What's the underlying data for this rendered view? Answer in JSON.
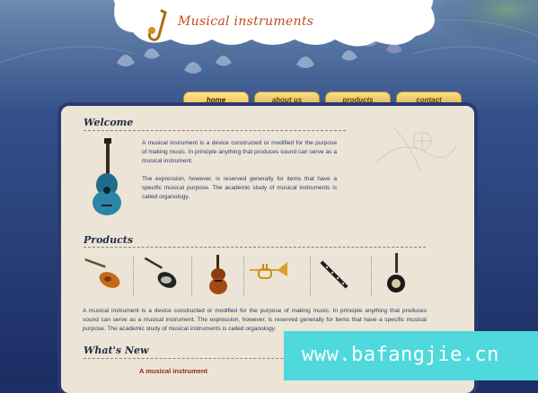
{
  "site": {
    "logo_text": "Musical instruments"
  },
  "nav": {
    "items": [
      "home",
      "about us",
      "products",
      "contact"
    ],
    "active": "home"
  },
  "welcome": {
    "heading": "Welcome",
    "paragraph1": "A musical instrument is a device constructed or modified for the purpose of making music. In principle anything that produces sound can serve as a musical instrument.",
    "paragraph2": "The expression, however, is reserved generally for items that have a specific musical purpose. The academic study of musical instruments is called organology."
  },
  "products": {
    "heading": "Products",
    "items": [
      "electric-guitar",
      "electric-guitar-black",
      "violin",
      "trumpet",
      "clarinet",
      "bass-guitar"
    ],
    "paragraph": "A musical instrument is a device constructed or modified for the purpose of making music. In principle anything that produces sound can serve as a musical instrument. The expression, however, is reserved generally for items that have a specific musical purpose. The academic study of musical instruments is called organology."
  },
  "whats_new": {
    "heading": "What's New",
    "item_title": "A musical instrument"
  },
  "watermark": {
    "text": "www.bafangjie.cn"
  },
  "colors": {
    "background": "#1c2f66",
    "panel": "#ece4d6",
    "accent": "#c14a18",
    "tab": "#f0bb3f",
    "watermark": "#4fd9dc"
  }
}
